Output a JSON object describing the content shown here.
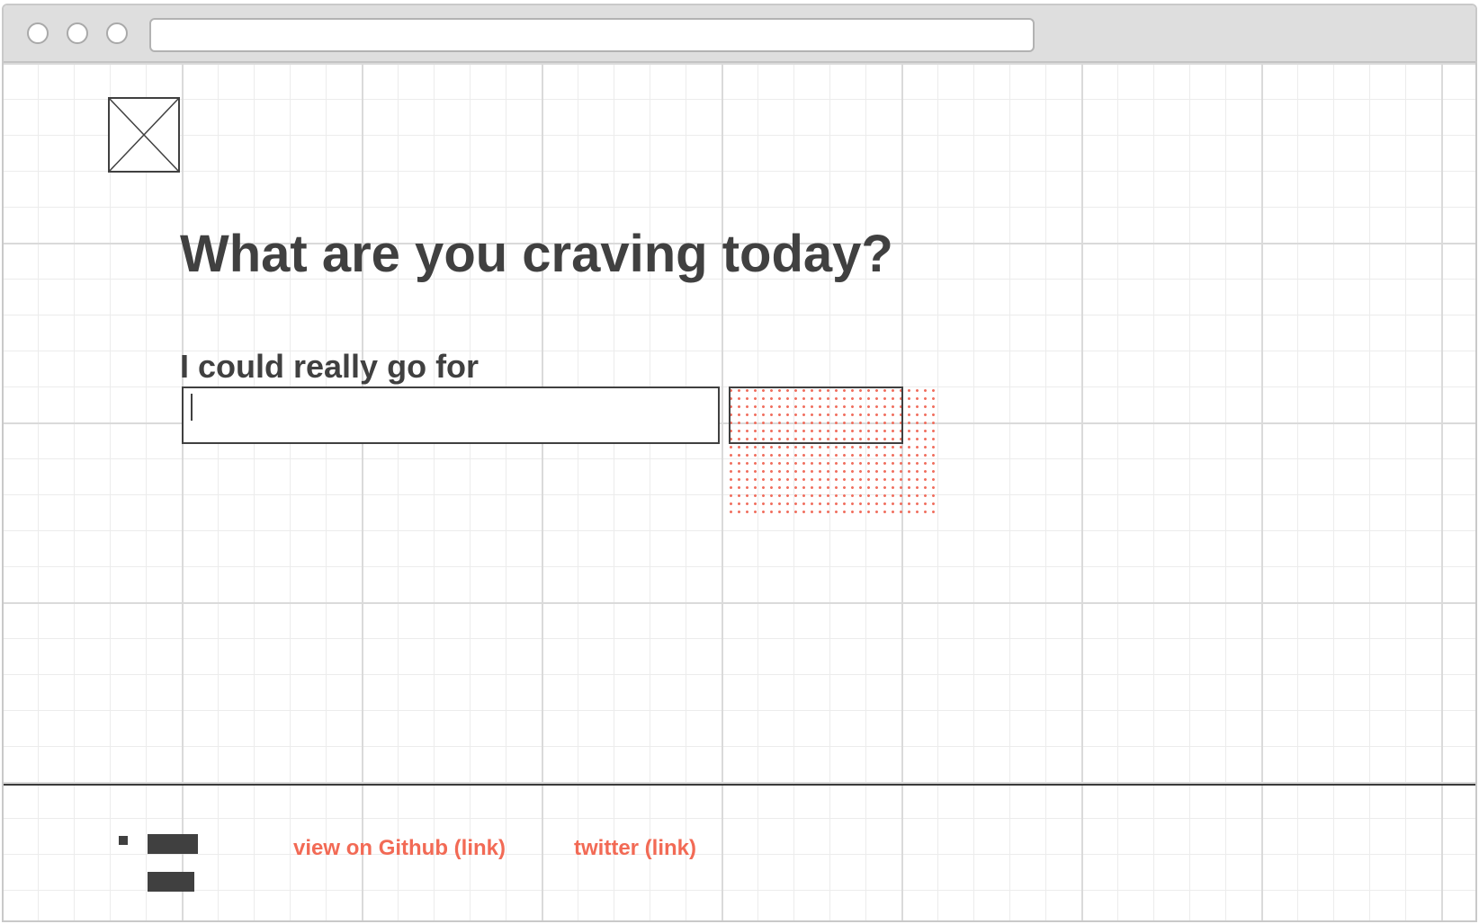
{
  "browser": {
    "window_buttons": [
      "close",
      "minimize",
      "maximize"
    ],
    "address_bar_value": ""
  },
  "logo": {
    "icon": "image-placeholder-icon"
  },
  "main": {
    "heading": "What are you craving today?",
    "input_label": "I could really go for",
    "input_value": "",
    "submit_label": ""
  },
  "footer": {
    "github_link": "view on Github (link)",
    "twitter_link": "twitter (link)"
  },
  "colors": {
    "text": "#404040",
    "accent": "#f26a55",
    "grid_major": "#dadada",
    "grid_minor": "#ececec",
    "titlebar": "#dedede"
  }
}
